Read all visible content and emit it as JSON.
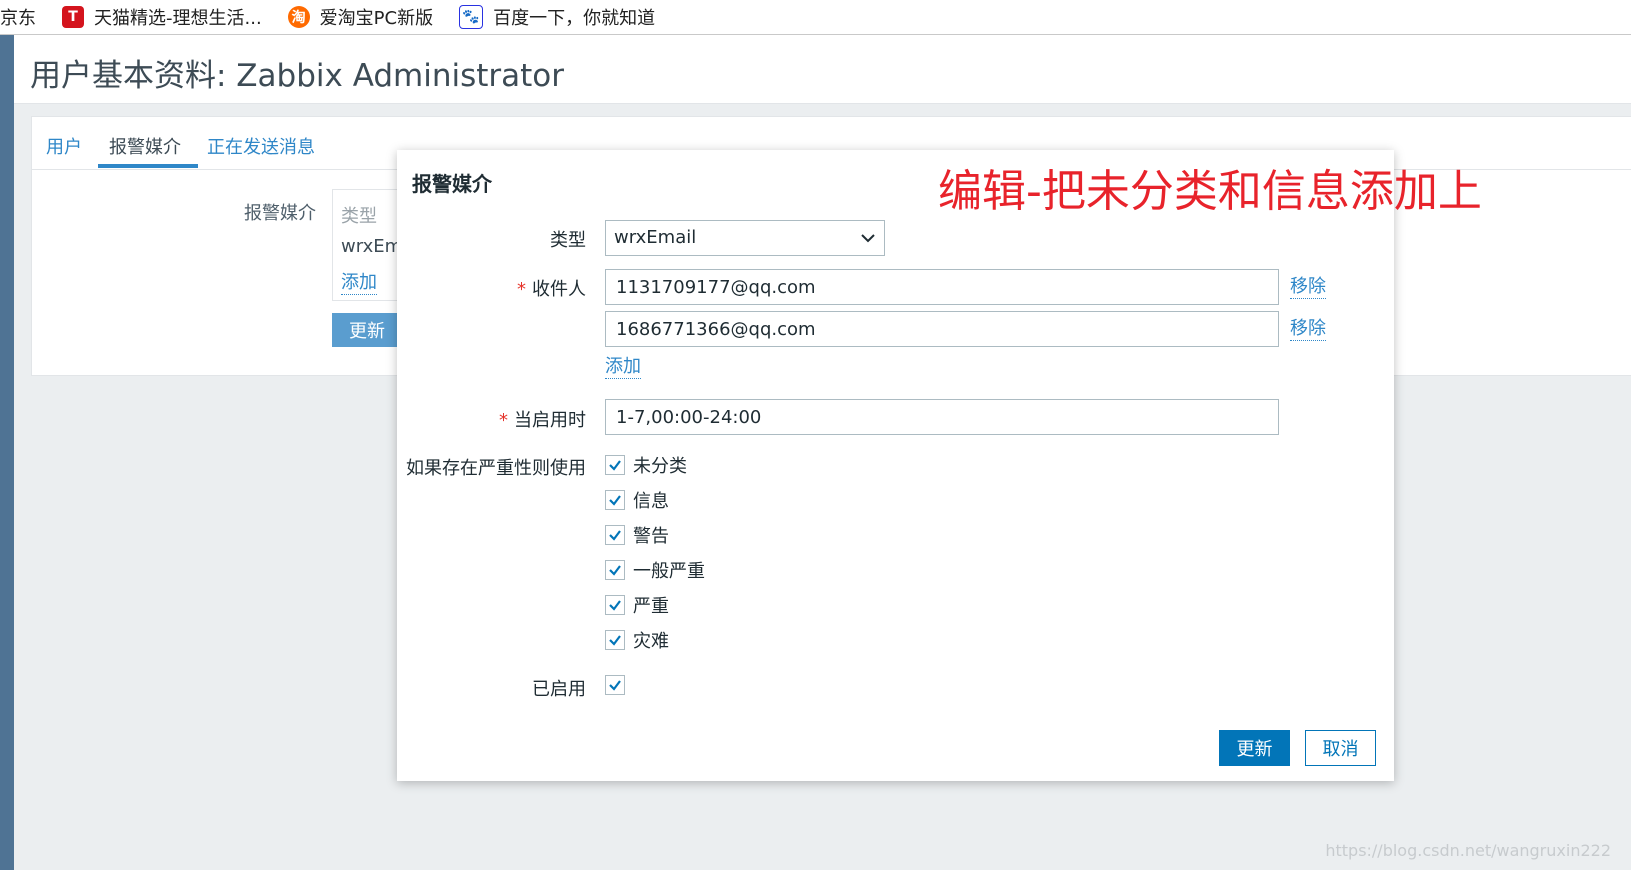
{
  "bookmarks": [
    {
      "label": "京东",
      "icon": ""
    },
    {
      "label": "天猫精选-理想生活...",
      "icon": "T"
    },
    {
      "label": "爱淘宝PC新版",
      "icon": "淘"
    },
    {
      "label": "百度一下，你就知道",
      "icon": "🐾"
    }
  ],
  "page": {
    "title": "用户基本资料: Zabbix Administrator"
  },
  "tabs": [
    {
      "label": "用户"
    },
    {
      "label": "报警媒介"
    },
    {
      "label": "正在发送消息"
    }
  ],
  "background_form": {
    "media_label": "报警媒介",
    "list_header": "类型",
    "list_row": "wrxEma",
    "add_link": "添加",
    "update_button": "更新"
  },
  "annotation": "编辑-把未分类和信息添加上",
  "modal": {
    "title": "报警媒介",
    "type_label": "类型",
    "type_value": "wrxEmail",
    "recipient_label": "收件人",
    "recipients": [
      "1131709177@qq.com",
      "1686771366@qq.com"
    ],
    "remove_link": "移除",
    "add_link": "添加",
    "when_active_label": "当启用时",
    "when_active_value": "1-7,00:00-24:00",
    "severity_label": "如果存在严重性则使用",
    "severities": [
      {
        "label": "未分类",
        "checked": true
      },
      {
        "label": "信息",
        "checked": true
      },
      {
        "label": "警告",
        "checked": true
      },
      {
        "label": "一般严重",
        "checked": true
      },
      {
        "label": "严重",
        "checked": true
      },
      {
        "label": "灾难",
        "checked": true
      }
    ],
    "enabled_label": "已启用",
    "enabled_checked": true,
    "update_button": "更新",
    "cancel_button": "取消"
  },
  "watermark": "https://blog.csdn.net/wangruxin222",
  "colors": {
    "accent": "#0275b8",
    "link": "#2f87c8",
    "annotation": "#e8232b",
    "required": "#e5332a"
  }
}
